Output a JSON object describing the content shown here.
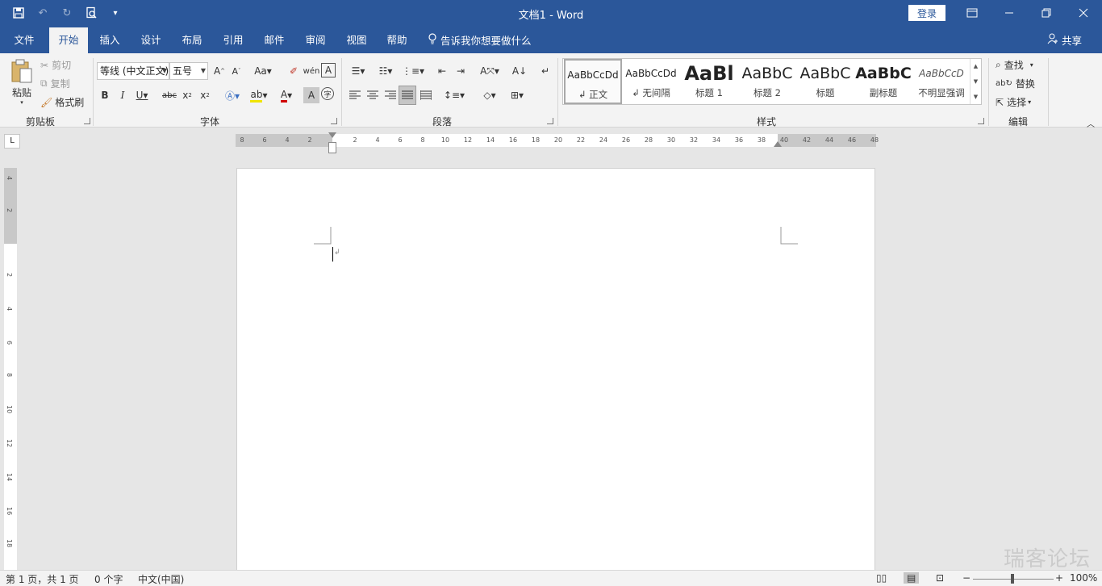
{
  "titlebar": {
    "doc_title": "文档1  -  Word",
    "login_label": "登录",
    "qat_icons": [
      "save-icon",
      "undo-icon",
      "redo-icon",
      "print-preview-icon",
      "customize-qat-icon"
    ],
    "accent": "#2b579a"
  },
  "tabs": [
    "文件",
    "开始",
    "插入",
    "设计",
    "布局",
    "引用",
    "邮件",
    "审阅",
    "视图",
    "帮助"
  ],
  "active_tab": "开始",
  "tellme": "告诉我你想要做什么",
  "share": "共享",
  "clipboard": {
    "paste": "粘贴",
    "cut": "剪切",
    "copy": "复制",
    "format_painter": "格式刷",
    "label": "剪贴板"
  },
  "font": {
    "name": "等线 (中文正文)",
    "size": "五号",
    "label": "字体"
  },
  "paragraph": {
    "label": "段落"
  },
  "styles": {
    "label": "样式",
    "items": [
      {
        "preview": "AaBbCcDd",
        "name": "↲ 正文"
      },
      {
        "preview": "AaBbCcDd",
        "name": "↲ 无间隔"
      },
      {
        "preview": "AaBl",
        "name": "标题 1"
      },
      {
        "preview": "AaBbC",
        "name": "标题 2"
      },
      {
        "preview": "AaBbC",
        "name": "标题"
      },
      {
        "preview": "AaBbC",
        "name": "副标题"
      },
      {
        "preview": "AaBbCcD",
        "name": "不明显强调"
      }
    ]
  },
  "editing": {
    "find": "查找",
    "replace": "替换",
    "select": "选择",
    "label": "编辑"
  },
  "hruler_ticks": [
    "8",
    "6",
    "4",
    "2",
    "2",
    "4",
    "6",
    "8",
    "10",
    "12",
    "14",
    "16",
    "18",
    "20",
    "22",
    "24",
    "26",
    "28",
    "30",
    "32",
    "34",
    "36",
    "38",
    "40",
    "42",
    "44",
    "46",
    "48"
  ],
  "vruler_ticks": [
    "4",
    "2",
    "2",
    "4",
    "6",
    "8",
    "10",
    "12",
    "14",
    "16",
    "18"
  ],
  "ruler_corner": "L",
  "statusbar": {
    "page": "第 1 页，共 1 页",
    "words": "0 个字",
    "lang": "中文(中国)",
    "zoom": "100%"
  },
  "watermark": "瑞客论坛"
}
